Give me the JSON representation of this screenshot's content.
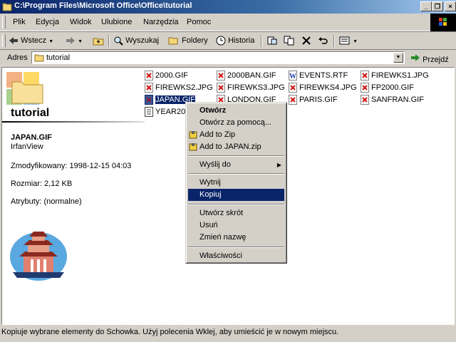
{
  "window": {
    "title": "C:\\Program Files\\Microsoft Office\\Office\\tutorial"
  },
  "menu": [
    "Plik",
    "Edycja",
    "Widok",
    "Ulubione",
    "Narzędzia",
    "Pomoc"
  ],
  "toolbar": {
    "back": "Wstecz",
    "search": "Wyszukaj",
    "folders": "Foldery",
    "history": "Historia"
  },
  "address": {
    "label": "Adres",
    "value": "tutorial",
    "go": "Przejdź"
  },
  "folder": {
    "title": "tutorial",
    "selected_name": "JAPAN.GIF",
    "selected_app": "IrfanView",
    "modified": "Zmodyfikowany: 1998-12-15 04:03",
    "size": "Rozmiar: 2,12 KB",
    "attributes": "Atrybuty: (normalne)"
  },
  "files": [
    {
      "name": "2000.GIF",
      "type": "img"
    },
    {
      "name": "2000BAN.GIF",
      "type": "img"
    },
    {
      "name": "EVENTS.RTF",
      "type": "doc"
    },
    {
      "name": "FIREWKS1.JPG",
      "type": "img"
    },
    {
      "name": "FIREWKS2.JPG",
      "type": "img"
    },
    {
      "name": "FIREWKS3.JPG",
      "type": "img"
    },
    {
      "name": "FIREWKS4.JPG",
      "type": "img"
    },
    {
      "name": "FP2000.GIF",
      "type": "img"
    },
    {
      "name": "JAPAN.GIF",
      "type": "img"
    },
    {
      "name": "LONDON.GIF",
      "type": "img"
    },
    {
      "name": "PARIS.GIF",
      "type": "img"
    },
    {
      "name": "SANFRAN.GIF",
      "type": "img"
    },
    {
      "name": "YEAR2000",
      "type": "txt"
    }
  ],
  "context_menu": {
    "open": "Otwórz",
    "open_with": "Otwórz za pomocą...",
    "add_zip": "Add to Zip",
    "add_named_zip": "Add to JAPAN.zip",
    "send_to": "Wyślij do",
    "cut": "Wytnij",
    "copy": "Kopiuj",
    "shortcut": "Utwórz skrót",
    "delete": "Usuń",
    "rename": "Zmień nazwę",
    "properties": "Właściwości"
  },
  "status": "Kopiuje wybrane elementy do Schowka. Użyj polecenia Wklej, aby umieścić je w nowym miejscu.",
  "colors": {
    "titlebar": "#0a246a",
    "highlight": "#0a246a",
    "face": "#d4d0c8"
  }
}
